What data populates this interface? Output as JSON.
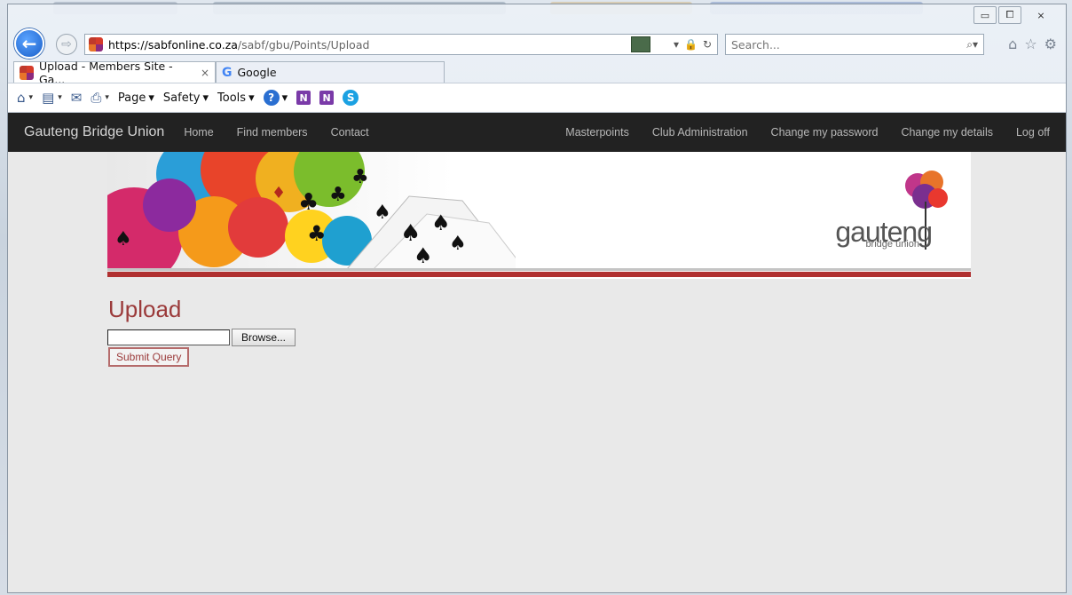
{
  "browser": {
    "url_prefix": "https://",
    "url_domain": "sabfonline.co.za",
    "url_path": "/sabf/gbu/Points/Upload",
    "search_placeholder": "Search...",
    "tabs": [
      {
        "label": "Upload - Members Site - Ga...",
        "active": true
      },
      {
        "label": "Google",
        "active": false
      }
    ],
    "commands": {
      "page": "Page",
      "safety": "Safety",
      "tools": "Tools"
    },
    "icons": {
      "home_cmd": "⌂",
      "feeds": "▤",
      "mail": "✉",
      "print": "⎙",
      "help": "?",
      "onenote1": "N",
      "onenote2": "N",
      "skype": "S",
      "back": "←",
      "forward": "⇨",
      "lock": "🔒",
      "refresh": "↻",
      "search": "⌕",
      "star": "☆",
      "gear": "⚙",
      "house": "⌂",
      "close_tab": "×",
      "minimize": "▭",
      "maximize": "⧠",
      "close": "⨯",
      "dropdown": "▾",
      "google_g": "G"
    }
  },
  "site": {
    "brand": "Gauteng Bridge Union",
    "nav_left": [
      "Home",
      "Find members",
      "Contact"
    ],
    "nav_right": [
      "Masterpoints",
      "Club Administration",
      "Change my password",
      "Change my details",
      "Log off"
    ],
    "logo_text": "gauteng",
    "logo_sub": "bridge union"
  },
  "form": {
    "title": "Upload",
    "browse_label": "Browse...",
    "submit_label": "Submit Query"
  },
  "colors": {
    "title_red": "#9b3a3a",
    "navbar": "#222222",
    "stripe_red": "#b03030"
  }
}
